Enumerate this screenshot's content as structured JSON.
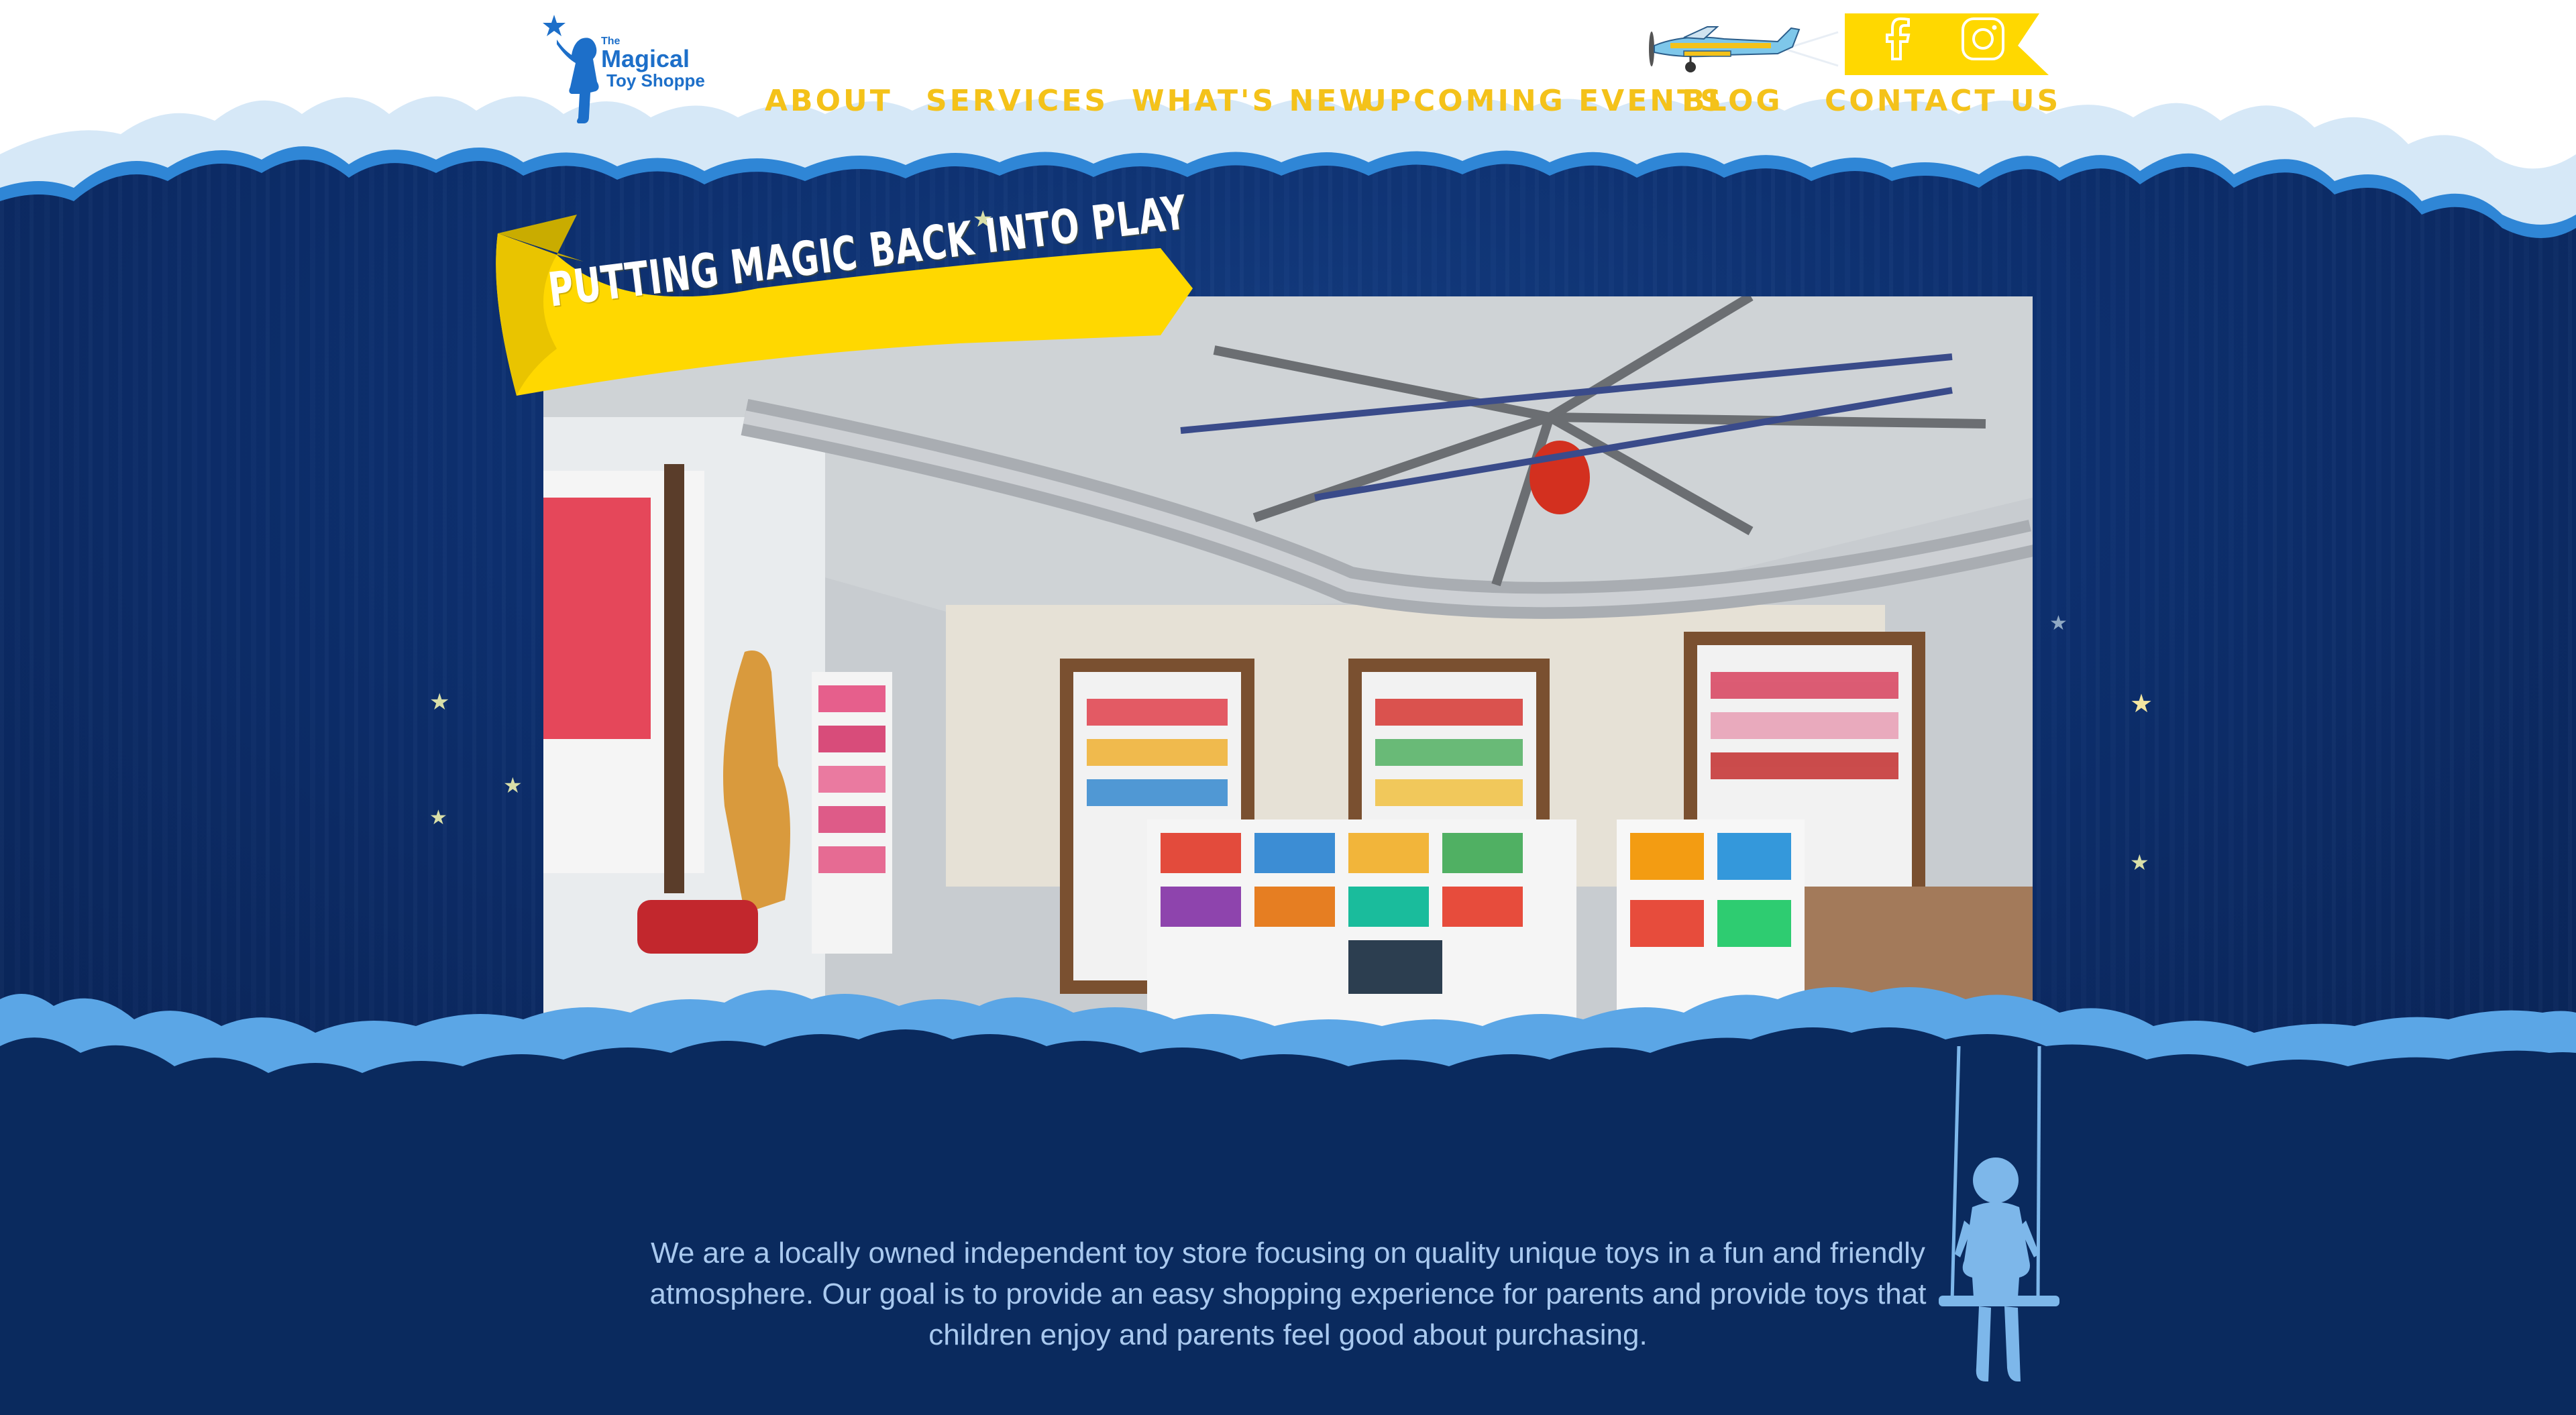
{
  "brand": {
    "logo_line1": "The",
    "logo_line2": "Magical",
    "logo_line3": "Toy Shoppe"
  },
  "nav": {
    "items": [
      {
        "label": "ABOUT"
      },
      {
        "label": "SERVICES"
      },
      {
        "label": "WHAT'S NEW"
      },
      {
        "label": "UPCOMING EVENTS"
      },
      {
        "label": "BLOG"
      },
      {
        "label": "CONTACT US"
      }
    ]
  },
  "social": {
    "icons": [
      "facebook-icon",
      "instagram-icon"
    ]
  },
  "hero": {
    "ribbon_text": "PUTTING MAGIC BACK INTO PLAY"
  },
  "intro": {
    "text": "We are a locally owned independent toy store focusing on quality unique toys in a fun and friendly atmosphere. Our goal is to provide an easy shopping experience for parents and provide toys that children enjoy and parents feel good about purchasing."
  },
  "colors": {
    "navy": "#0a2a5e",
    "sky": "#0d3070",
    "cloud": "#d6e8f7",
    "cloud_edge": "#2f86d6",
    "nav_gold": "#f4c21a",
    "ribbon_yellow": "#ffd800",
    "swing_blue": "#7db7ea"
  }
}
